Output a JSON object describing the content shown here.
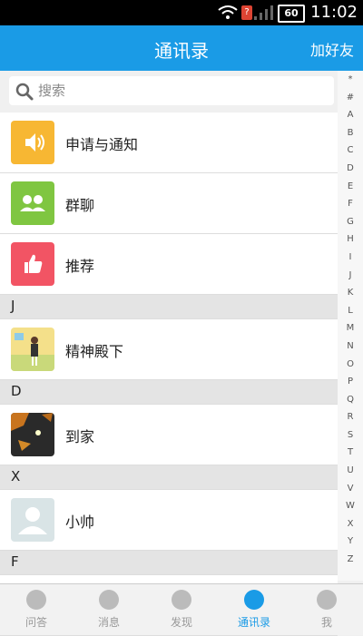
{
  "status_bar": {
    "time": "11:02",
    "battery": "60"
  },
  "header": {
    "title": "通讯录",
    "action": "加好友"
  },
  "search": {
    "placeholder": "搜索"
  },
  "top_items": [
    {
      "label": "申请与通知",
      "color": "#f7b733",
      "icon": "speaker-icon"
    },
    {
      "label": "群聊",
      "color": "#7fc641",
      "icon": "group-icon"
    },
    {
      "label": "推荐",
      "color": "#f25464",
      "icon": "thumbs-up-icon"
    }
  ],
  "contact_sections": [
    {
      "letter": "J",
      "contacts": [
        {
          "name": "精神殿下"
        }
      ]
    },
    {
      "letter": "D",
      "contacts": [
        {
          "name": "到家"
        }
      ]
    },
    {
      "letter": "X",
      "contacts": [
        {
          "name": "小帅"
        }
      ]
    },
    {
      "letter": "F",
      "contacts": []
    }
  ],
  "index_letters": [
    "*",
    "#",
    "A",
    "B",
    "C",
    "D",
    "E",
    "F",
    "G",
    "H",
    "I",
    "J",
    "K",
    "L",
    "M",
    "N",
    "O",
    "P",
    "Q",
    "R",
    "S",
    "T",
    "U",
    "V",
    "W",
    "X",
    "Y",
    "Z"
  ],
  "bottom_nav": [
    {
      "label": "问答"
    },
    {
      "label": "消息"
    },
    {
      "label": "发现"
    },
    {
      "label": "通讯录",
      "active": true
    },
    {
      "label": "我"
    }
  ],
  "colors": {
    "accent": "#1a9be6"
  }
}
